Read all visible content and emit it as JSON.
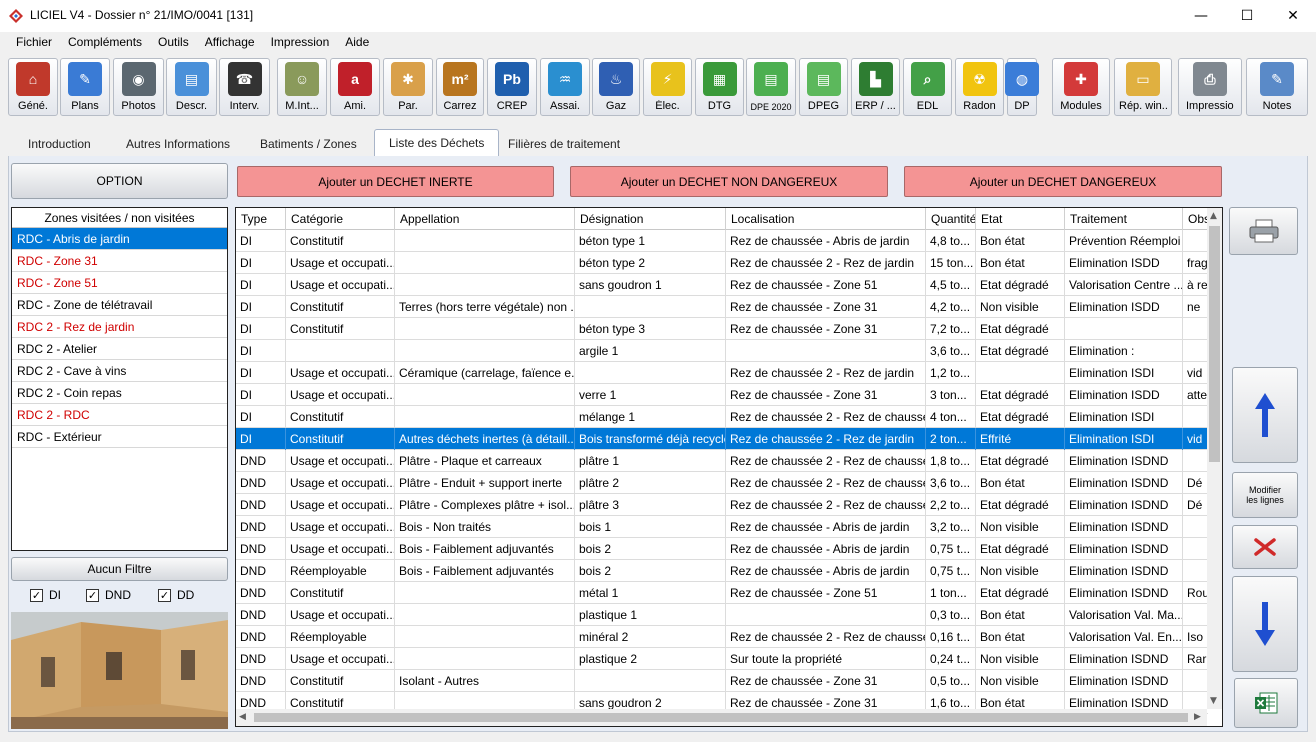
{
  "window": {
    "title": "LICIEL V4 - Dossier n° 21/IMO/0041 [131]",
    "minimize": "—",
    "maximize": "☐",
    "close": "✕"
  },
  "menu": [
    {
      "label": "Fichier"
    },
    {
      "label": "Compléments"
    },
    {
      "label": "Outils"
    },
    {
      "label": "Affichage"
    },
    {
      "label": "Impression"
    },
    {
      "label": "Aide"
    }
  ],
  "toolbar": [
    {
      "label": "Géné.",
      "icon": "house-icon",
      "color": "#c0392b",
      "glyph": "⌂"
    },
    {
      "label": "Plans",
      "icon": "plan-pencil-icon",
      "color": "#3a7bd5",
      "glyph": "✎"
    },
    {
      "label": "Photos",
      "icon": "camera-icon",
      "color": "#5b6770",
      "glyph": "◉"
    },
    {
      "label": "Descr.",
      "icon": "document-icon",
      "color": "#4a90d9",
      "glyph": "▤"
    },
    {
      "label": "Interv.",
      "icon": "phone-icon",
      "color": "#333333",
      "glyph": "☎"
    },
    {
      "label": "M.Int...",
      "icon": "person-icon",
      "color": "#8a9a5b",
      "glyph": "☺"
    },
    {
      "label": "Ami.",
      "icon": "asbestos-icon",
      "color": "#c0202a",
      "glyph": "a"
    },
    {
      "label": "Par.",
      "icon": "termite-icon",
      "color": "#d9a04a",
      "glyph": "✱"
    },
    {
      "label": "Carrez",
      "icon": "square-meter-icon",
      "color": "#b8751f",
      "glyph": "m²"
    },
    {
      "label": "CREP",
      "icon": "lead-icon",
      "color": "#1f5fae",
      "glyph": "Pb"
    },
    {
      "label": "Assai.",
      "icon": "faucet-icon",
      "color": "#2a8fd0",
      "glyph": "♒"
    },
    {
      "label": "Gaz",
      "icon": "gas-flame-icon",
      "color": "#2f5fb3",
      "glyph": "♨"
    },
    {
      "label": "Élec.",
      "icon": "plug-icon",
      "color": "#e8c21c",
      "glyph": "⚡"
    },
    {
      "label": "DTG",
      "icon": "building-icon",
      "color": "#3a9a3a",
      "glyph": "▦"
    },
    {
      "label": "DPE 2020",
      "icon": "energy-label-icon",
      "color": "#4caf50",
      "glyph": "▤"
    },
    {
      "label": "DPEG",
      "icon": "energy-label-icon",
      "color": "#5cb85c",
      "glyph": "▤"
    },
    {
      "label": "ERP / ...",
      "icon": "factory-icon",
      "color": "#2e7d32",
      "glyph": "▙"
    },
    {
      "label": "EDL",
      "icon": "magnifier-icon",
      "color": "#43a047",
      "glyph": "⌕"
    },
    {
      "label": "Radon",
      "icon": "radiation-icon",
      "color": "#f1c40f",
      "glyph": "☢"
    },
    {
      "label": "DP",
      "icon": "globe-icon",
      "color": "#3b7dd8",
      "glyph": "◍"
    },
    {
      "label": "Modules",
      "icon": "puzzle-icon",
      "color": "#d33a3a",
      "glyph": "✚"
    },
    {
      "label": "Rép. win...",
      "icon": "folder-icon",
      "color": "#e0b040",
      "glyph": "▭"
    },
    {
      "label": "Impression",
      "icon": "printer-icon",
      "color": "#808890",
      "glyph": "⎙"
    },
    {
      "label": "Notes",
      "icon": "notes-icon",
      "color": "#5a8ac8",
      "glyph": "✎"
    }
  ],
  "tabs": [
    {
      "label": "Introduction"
    },
    {
      "label": "Autres Informations"
    },
    {
      "label": "Batiments / Zones"
    },
    {
      "label": "Liste des Déchets"
    },
    {
      "label": "Filières de traitement"
    }
  ],
  "buttons": {
    "option": "OPTION",
    "add_inerte": "Ajouter un DECHET INERTE",
    "add_non_dangereux": "Ajouter un DECHET NON DANGEREUX",
    "add_dangereux": "Ajouter un DECHET DANGEREUX",
    "aucun_filtre": "Aucun Filtre",
    "modifier_line1": "Modifier",
    "modifier_line2": "les lignes"
  },
  "zones": {
    "header": "Zones visitées / non visitées",
    "items": [
      {
        "label": "RDC - Abris de jardin",
        "state": "sel"
      },
      {
        "label": "RDC - Zone 31",
        "state": "red"
      },
      {
        "label": "RDC - Zone 51",
        "state": "red"
      },
      {
        "label": "RDC - Zone de télétravail",
        "state": ""
      },
      {
        "label": "RDC 2 - Rez de jardin",
        "state": "red"
      },
      {
        "label": "RDC 2 - Atelier",
        "state": ""
      },
      {
        "label": "RDC 2 - Cave à vins",
        "state": ""
      },
      {
        "label": "RDC 2 - Coin repas",
        "state": ""
      },
      {
        "label": "RDC 2 - RDC",
        "state": "red"
      },
      {
        "label": "RDC - Extérieur",
        "state": ""
      }
    ]
  },
  "filters": [
    {
      "label": "DI",
      "checked": "✓"
    },
    {
      "label": "DND",
      "checked": "✓"
    },
    {
      "label": "DD",
      "checked": "✓"
    }
  ],
  "grid": {
    "columns": [
      "Type",
      "Catégorie",
      "Appellation",
      "Désignation",
      "Localisation",
      "Quantité",
      "Etat",
      "Traitement",
      "Observ."
    ],
    "rows": [
      [
        "DI",
        "Constitutif",
        "",
        "béton type 1",
        "Rez de chaussée - Abris de jardin",
        "4,8 to...",
        "Bon état",
        "Prévention Réemploi",
        ""
      ],
      [
        "DI",
        "Usage et occupati...",
        "",
        "béton type 2",
        "Rez de chaussée 2 - Rez de jardin",
        "15 ton...",
        "Bon état",
        "Elimination ISDD",
        "frag"
      ],
      [
        "DI",
        "Usage et occupati...",
        "",
        "sans goudron 1",
        "Rez de chaussée - Zone 51",
        "4,5 to...",
        "Etat dégradé",
        "Valorisation Centre ...",
        "à re"
      ],
      [
        "DI",
        "Constitutif",
        "Terres (hors terre végétale) non ...",
        "",
        "Rez de chaussée - Zone 31",
        "4,2 to...",
        "Non visible",
        "Elimination ISDD",
        "ne"
      ],
      [
        "DI",
        "Constitutif",
        "",
        "béton type 3",
        "Rez de chaussée - Zone 31",
        "7,2 to...",
        "Etat dégradé",
        "",
        ""
      ],
      [
        "DI",
        "",
        "",
        "argile 1",
        "",
        "3,6 to...",
        "Etat dégradé",
        "Elimination :",
        ""
      ],
      [
        "DI",
        "Usage et occupati...",
        "Céramique (carrelage, faïence e...",
        "",
        "Rez de chaussée 2 - Rez de jardin",
        "1,2 to...",
        "",
        "Elimination ISDI",
        "vid"
      ],
      [
        "DI",
        "Usage et occupati...",
        "",
        "verre 1",
        "Rez de chaussée - Zone 31",
        "3 ton...",
        "Etat dégradé",
        "Elimination ISDD",
        "atte"
      ],
      [
        "DI",
        "Constitutif",
        "",
        "mélange 1",
        "Rez de chaussée 2 - Rez de chaussée",
        "4 ton...",
        "Etat dégradé",
        "Elimination ISDI",
        ""
      ],
      [
        "DI",
        "Constitutif",
        "Autres déchets inertes (à détaill...",
        "Bois transformé déjà recyclé",
        "Rez de chaussée 2 - Rez de jardin",
        "2 ton...",
        "Effrité",
        "Elimination ISDI",
        "vid"
      ],
      [
        "DND",
        "Usage et occupati...",
        "Plâtre - Plaque et carreaux",
        "plâtre 1",
        "Rez de chaussée 2 - Rez de chaussée",
        "1,8 to...",
        "Etat dégradé",
        "Elimination ISDND",
        ""
      ],
      [
        "DND",
        "Usage et occupati...",
        "Plâtre - Enduit + support inerte",
        "plâtre 2",
        "Rez de chaussée 2 - Rez de chaussée",
        "3,6 to...",
        "Bon état",
        "Elimination ISDND",
        "Dé"
      ],
      [
        "DND",
        "Usage et occupati...",
        "Plâtre - Complexes plâtre + isol...",
        "plâtre 3",
        "Rez de chaussée 2 - Rez de chaussée",
        "2,2 to...",
        "Etat dégradé",
        "Elimination ISDND",
        "Dé"
      ],
      [
        "DND",
        "Usage et occupati...",
        "Bois - Non traités",
        "bois 1",
        "Rez de chaussée - Abris de jardin",
        "3,2 to...",
        "Non visible",
        "Elimination ISDND",
        ""
      ],
      [
        "DND",
        "Usage et occupati...",
        "Bois - Faiblement adjuvantés",
        "bois 2",
        "Rez de chaussée - Abris de jardin",
        "0,75 t...",
        "Etat dégradé",
        "Elimination ISDND",
        ""
      ],
      [
        "DND",
        "Réemployable",
        "Bois - Faiblement adjuvantés",
        "bois 2",
        "Rez de chaussée - Abris de jardin",
        "0,75 t...",
        "Non visible",
        "Elimination ISDND",
        ""
      ],
      [
        "DND",
        "Constitutif",
        "",
        "métal 1",
        "Rez de chaussée - Zone 51",
        "1 ton...",
        "Etat dégradé",
        "Elimination ISDND",
        "Rou"
      ],
      [
        "DND",
        "Usage et occupati...",
        "",
        "plastique 1",
        "",
        "0,3 to...",
        "Bon état",
        "Valorisation Val. Ma...",
        ""
      ],
      [
        "DND",
        "Réemployable",
        "",
        "minéral 2",
        "Rez de chaussée 2 - Rez de chaussée",
        "0,16 t...",
        "Bon état",
        "Valorisation Val. En...",
        "Iso"
      ],
      [
        "DND",
        "Usage et occupati...",
        "",
        "plastique 2",
        "Sur toute la propriété",
        "0,24 t...",
        "Non visible",
        "Elimination ISDND",
        "Rar"
      ],
      [
        "DND",
        "Constitutif",
        "Isolant - Autres",
        "",
        "Rez de chaussée - Zone 31",
        "0,5 to...",
        "Non visible",
        "Elimination ISDND",
        ""
      ],
      [
        "DND",
        "Constitutif",
        "",
        "sans goudron 2",
        "Rez de chaussée - Zone 31",
        "1,6 to...",
        "Bon état",
        "Elimination ISDND",
        ""
      ]
    ],
    "selected_row": 9
  },
  "colors": {
    "selection": "#0078d7",
    "red_text": "#d00000",
    "add_button": "#f49494",
    "arrow_blue": "#1f4fd0"
  }
}
